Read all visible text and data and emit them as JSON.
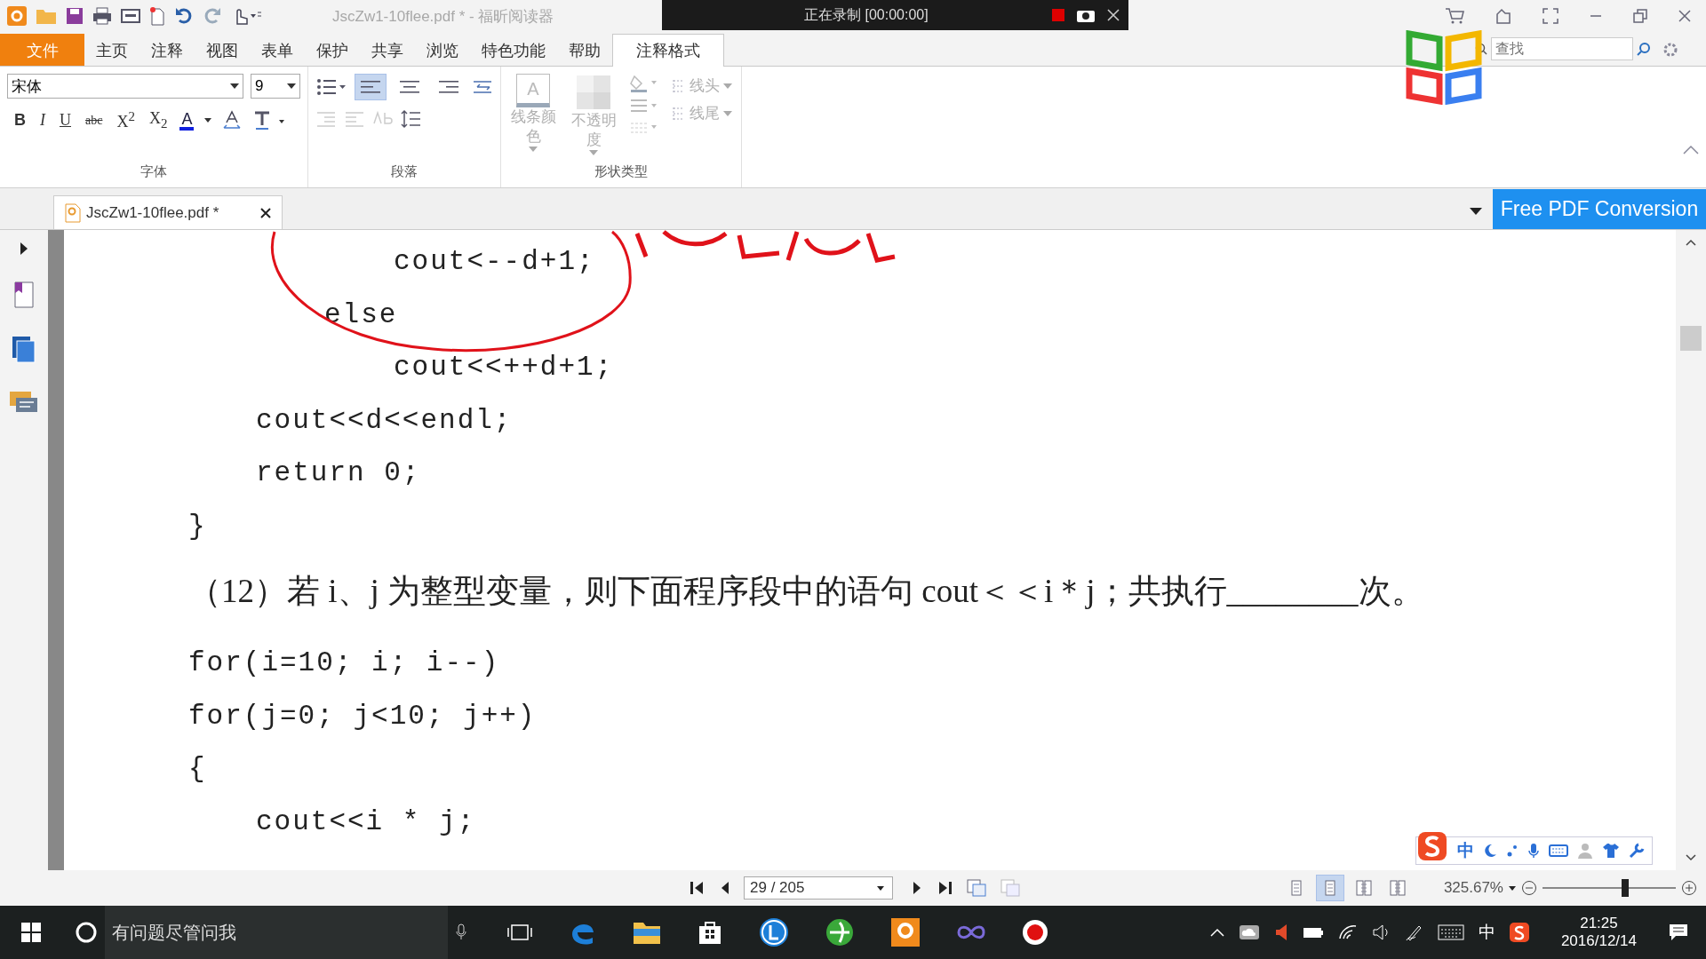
{
  "title_bar": {
    "title": "JscZw1-10flee.pdf * - 福昕阅读器"
  },
  "recorder_bar": {
    "status": "正在录制 [00:00:00]"
  },
  "menu_tabs": [
    {
      "label": "文件",
      "kind": "file",
      "selected": false
    },
    {
      "label": "主页",
      "kind": "tab",
      "selected": false
    },
    {
      "label": "注释",
      "kind": "tab",
      "selected": false
    },
    {
      "label": "视图",
      "kind": "tab",
      "selected": false
    },
    {
      "label": "表单",
      "kind": "tab",
      "selected": false
    },
    {
      "label": "保护",
      "kind": "tab",
      "selected": false
    },
    {
      "label": "共享",
      "kind": "tab",
      "selected": false
    },
    {
      "label": "浏览",
      "kind": "tab",
      "selected": false
    },
    {
      "label": "特色功能",
      "kind": "tab",
      "selected": false
    },
    {
      "label": "帮助",
      "kind": "tab",
      "selected": false
    },
    {
      "label": "注释格式",
      "kind": "tab",
      "selected": true
    }
  ],
  "search": {
    "placeholder": "查找"
  },
  "ribbon": {
    "font_group": {
      "label": "字体",
      "font": "宋体",
      "size": "9",
      "format_buttons": [
        "B",
        "I",
        "U",
        "abc",
        "X$^{2}$",
        "X$_{2}$"
      ],
      "color_button": "A"
    },
    "paragraph_group": {
      "label": "段落",
      "alignments": [
        {
          "selected": true
        },
        {
          "selected": false
        },
        {
          "selected": false
        }
      ]
    },
    "shape_group": {
      "label": "形状类型",
      "buttons": [
        {
          "label": "线条颜色",
          "kind": "color",
          "glyph": "A",
          "disabled": true
        },
        {
          "label": "不透明度",
          "kind": "opacity",
          "disabled": true
        },
        {
          "label": "线头",
          "kind": "line",
          "disabled": true
        },
        {
          "label": "线尾",
          "kind": "line",
          "disabled": true
        }
      ]
    }
  },
  "doc_tabs": [
    {
      "label": "JscZw1-10flee.pdf *",
      "selected": true
    }
  ],
  "promo_button": "Free PDF Conversion",
  "document": [
    {
      "text": "cout<--d+1;",
      "kind": "deep"
    },
    {
      "text": "else",
      "kind": "inner"
    },
    {
      "text": "cout<<++d+1;",
      "kind": "deep"
    },
    {
      "text": "cout<<d<<endl;",
      "kind": "body"
    },
    {
      "text": "return 0;",
      "kind": "body"
    },
    {
      "text": "}",
      "kind": "top"
    },
    {
      "text": "（12）若 i、j 为整型变量，则下面程序段中的语句 cout＜＜i＊j；共执行________次。",
      "kind": "question"
    },
    {
      "text": "for(i=10; i; i--)",
      "kind": "top"
    },
    {
      "text": "for(j=0; j<10; j++)",
      "kind": "top"
    },
    {
      "text": "{",
      "kind": "top"
    },
    {
      "text": "cout<<i * j;",
      "kind": "body"
    }
  ],
  "status_bar": {
    "page": "29 / 205",
    "zoom": "325.67%",
    "level": 0.62,
    "view_modes": [
      {
        "selected": false
      },
      {
        "selected": true
      },
      {
        "selected": false
      },
      {
        "selected": false
      }
    ]
  },
  "ime_bar": {
    "mode": "中"
  },
  "taskbar": {
    "search_placeholder": "有问题尽管问我",
    "input_mode": "中",
    "time": "21:25",
    "date": "2016/12/14"
  }
}
